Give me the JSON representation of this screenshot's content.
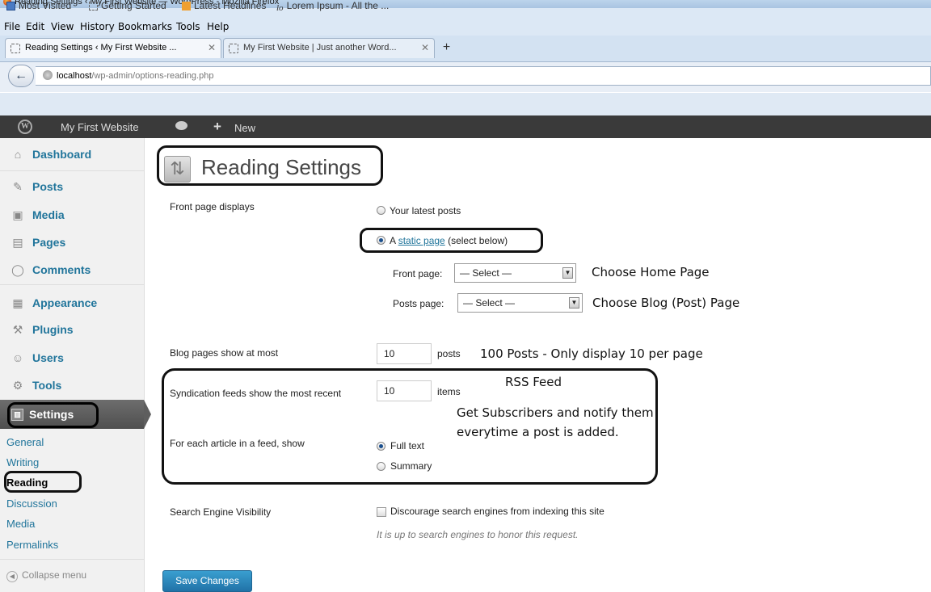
{
  "window": {
    "title": "Reading Settings ‹ My First Website — WordPress - Mozilla Firefox"
  },
  "menu": {
    "file": "File",
    "edit": "Edit",
    "view": "View",
    "history": "History",
    "bookmarks": "Bookmarks",
    "tools": "Tools",
    "help": "Help"
  },
  "tabs": [
    {
      "label": "Reading Settings ‹ My First Website ..."
    },
    {
      "label": "My First Website | Just another Word..."
    }
  ],
  "address": {
    "host": "localhost",
    "path": "/wp-admin/options-reading.php"
  },
  "bookmarks": {
    "most_visited": "Most Visited",
    "getting_started": "Getting Started",
    "latest_headlines": "Latest Headlines",
    "lorem": "Lorem Ipsum - All the ..."
  },
  "adminbar": {
    "site_name": "My First Website",
    "new_label": "New"
  },
  "sidebar": {
    "items": [
      {
        "label": "Dashboard"
      },
      {
        "label": "Posts"
      },
      {
        "label": "Media"
      },
      {
        "label": "Pages"
      },
      {
        "label": "Comments"
      },
      {
        "label": "Appearance"
      },
      {
        "label": "Plugins"
      },
      {
        "label": "Users"
      },
      {
        "label": "Tools"
      },
      {
        "label": "Settings"
      }
    ],
    "submenu": [
      "General",
      "Writing",
      "Reading",
      "Discussion",
      "Media",
      "Permalinks"
    ],
    "collapse": "Collapse menu"
  },
  "main": {
    "title": "Reading Settings",
    "front_page_displays": "Front page displays",
    "opt_latest": "Your latest posts",
    "opt_static_prefix": "A",
    "opt_static_link": "static page",
    "opt_static_suffix": "(select below)",
    "front_page_label": "Front page:",
    "front_page_value": "— Select —",
    "posts_page_label": "Posts page:",
    "posts_page_value": "— Select —",
    "blog_pages_label": "Blog pages show at most",
    "blog_pages_value": "10",
    "blog_pages_unit": "posts",
    "syndication_label": "Syndication feeds show the most recent",
    "syndication_value": "10",
    "syndication_unit": "items",
    "article_label": "For each article in a feed, show",
    "opt_full": "Full text",
    "opt_summary": "Summary",
    "seo_label": "Search Engine Visibility",
    "seo_checkbox": "Discourage search engines from indexing this site",
    "seo_note": "It is up to search engines to honor this request.",
    "save": "Save Changes"
  },
  "annotations": {
    "home": "Choose Home Page",
    "blog": "Choose Blog (Post) Page",
    "posts": "100 Posts - Only display 10 per page",
    "rss": "RSS Feed",
    "subscribers": "Get Subscribers and notify them everytime a post is added."
  }
}
